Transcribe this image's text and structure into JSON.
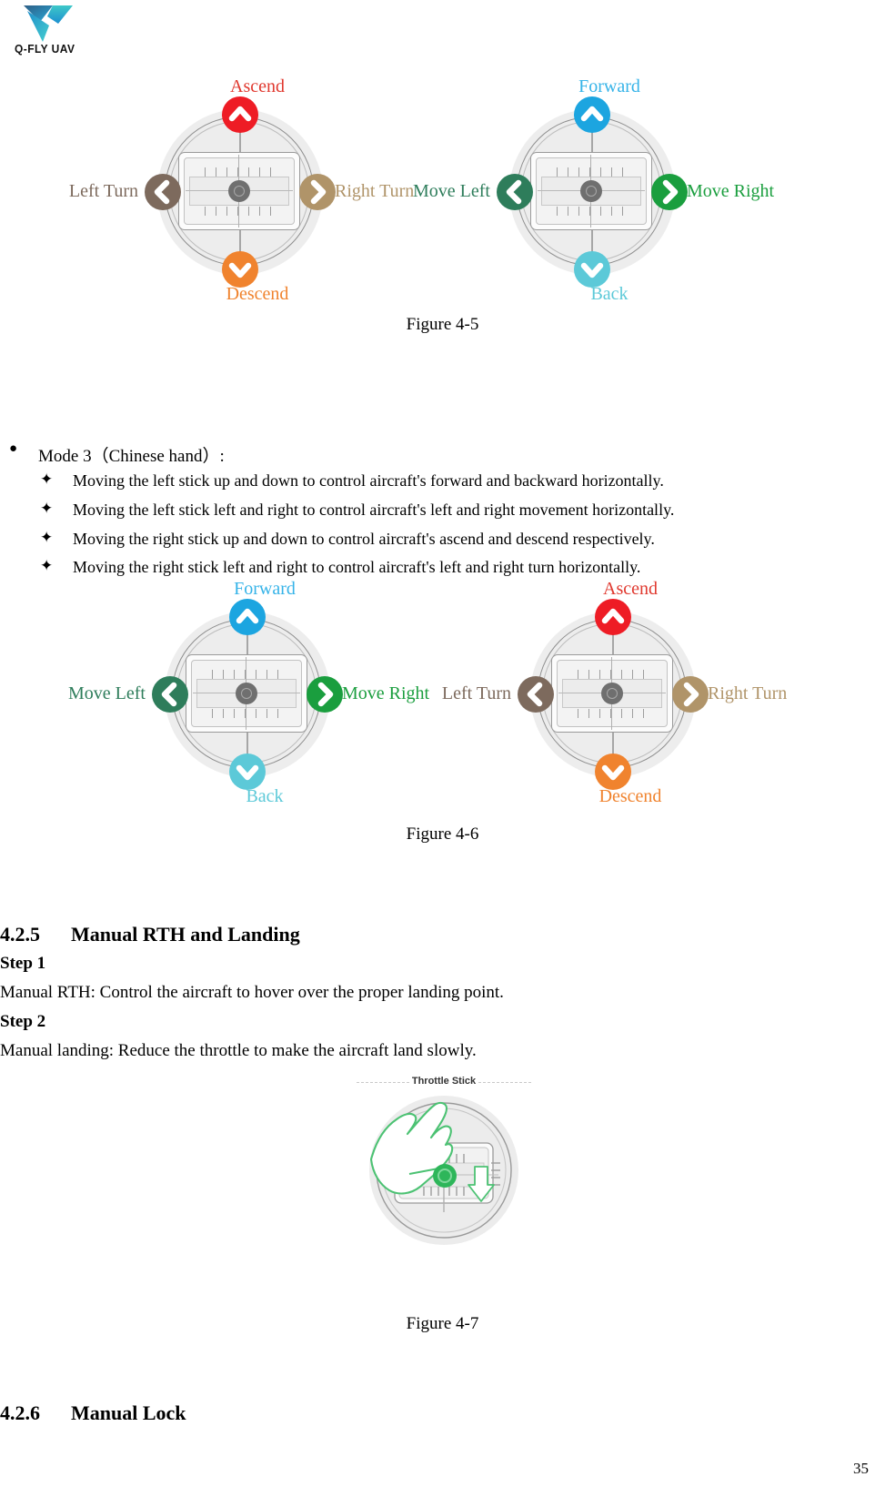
{
  "header": {
    "logo_text": "Q-FLY UAV",
    "logo_icon": "qfly-triangle-logo"
  },
  "figure_4_5": {
    "caption": "Figure 4-5",
    "left_stick": {
      "name": "left-stick-diagram",
      "up": "Ascend",
      "down": "Descend",
      "left": "Left Turn",
      "right": "Right Turn",
      "colors": {
        "up": "#ee1c25",
        "down": "#f0832e",
        "left": "#7d6a5d",
        "right": "#b09469",
        "up_text": "#e0392f",
        "down_text": "#f0832e",
        "left_text": "#7d6a5d",
        "right_text": "#b09469"
      }
    },
    "right_stick": {
      "name": "right-stick-diagram",
      "up": "Forward",
      "down": "Back",
      "left": "Move Left",
      "right": "Move Right",
      "colors": {
        "up": "#1ca5e0",
        "down": "#5cc9d8",
        "left": "#2e7d5b",
        "right": "#1a9e3e",
        "up_text": "#35b3e8",
        "down_text": "#5cc9d8",
        "left_text": "#2e7d5b",
        "right_text": "#1a9e3e"
      }
    }
  },
  "mode3": {
    "bullet": "Mode 3（Chinese hand）:",
    "items": [
      "Moving the left stick up and down to control aircraft's forward and backward horizontally.",
      "Moving the left stick left and right to control aircraft's left and right movement horizontally.",
      "Moving the right stick up and down to control aircraft's ascend and descend respectively.",
      "Moving the right stick left and right to control aircraft's left and right turn horizontally."
    ]
  },
  "figure_4_6": {
    "caption": "Figure 4-6",
    "left_stick": {
      "name": "mode3-left-stick-diagram",
      "up": "Forward",
      "down": "Back",
      "left": "Move Left",
      "right": "Move Right",
      "colors": {
        "up": "#1ca5e0",
        "down": "#5cc9d8",
        "left": "#2e7d5b",
        "right": "#1a9e3e",
        "up_text": "#35b3e8",
        "down_text": "#5cc9d8",
        "left_text": "#2e7d5b",
        "right_text": "#1a9e3e"
      }
    },
    "right_stick": {
      "name": "mode3-right-stick-diagram",
      "up": "Ascend",
      "down": "Descend",
      "left": "Left Turn",
      "right": "Right Turn",
      "colors": {
        "up": "#ee1c25",
        "down": "#f0832e",
        "left": "#7d6a5d",
        "right": "#b09469",
        "up_text": "#e0392f",
        "down_text": "#f0832e",
        "left_text": "#7d6a5d",
        "right_text": "#b09469"
      }
    }
  },
  "section_425": {
    "number": "4.2.5",
    "title": "Manual RTH and Landing",
    "step1_label": "Step 1",
    "step1_text": "Manual RTH: Control the aircraft to hover over the proper landing point.",
    "step2_label": "Step 2",
    "step2_text": "Manual landing: Reduce the throttle to make the aircraft land slowly."
  },
  "figure_4_7": {
    "caption": "Figure 4-7",
    "throttle_label": "Throttle Stick",
    "accent_color": "#2eb65a"
  },
  "section_426": {
    "number": "4.2.6",
    "title": "Manual Lock"
  },
  "footer": {
    "page_number": "35"
  }
}
